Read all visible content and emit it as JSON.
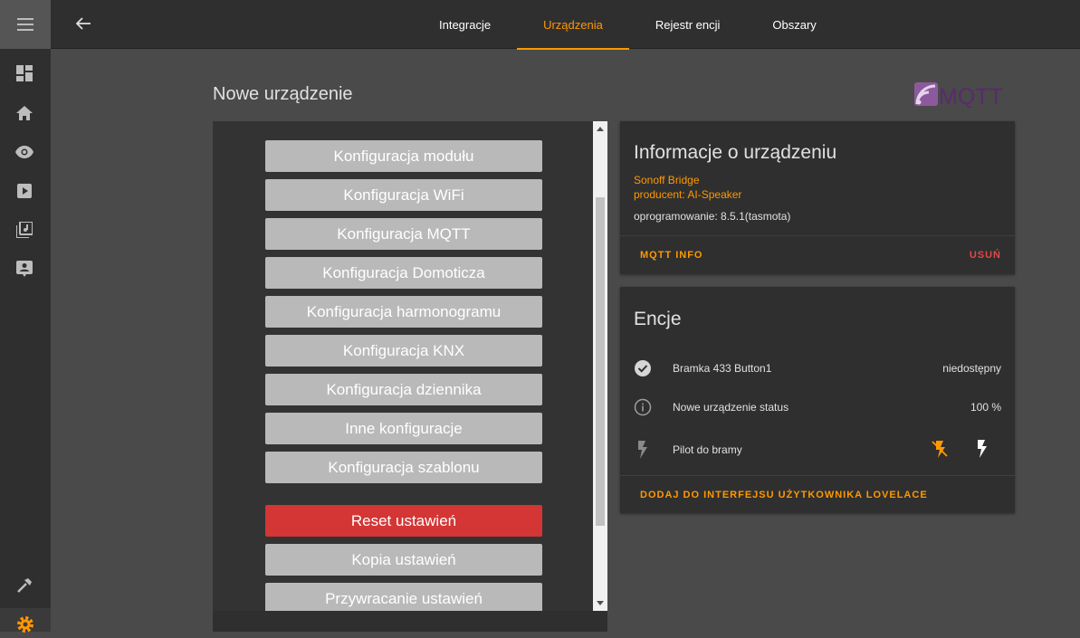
{
  "tabs": [
    "Integracje",
    "Urządzenia",
    "Rejestr encji",
    "Obszary"
  ],
  "active_tab": "Urządzenia",
  "page_title": "Nowe urządzenie",
  "logo_text": "MQTT",
  "config_buttons": [
    "Konfiguracja modułu",
    "Konfiguracja WiFi",
    "Konfiguracja MQTT",
    "Konfiguracja Domoticza",
    "Konfiguracja harmonogramu",
    "Konfiguracja KNX",
    "Konfiguracja dziennika",
    "Inne konfiguracje",
    "Konfiguracja szablonu"
  ],
  "reset_button": "Reset ustawień",
  "backup_button": "Kopia ustawień",
  "restore_button": "Przywracanie ustawień",
  "device_info": {
    "title": "Informacje o urządzeniu",
    "model": "Sonoff Bridge",
    "manufacturer": "producent: AI-Speaker",
    "firmware": "oprogramowanie: 8.5.1(tasmota)",
    "mqtt_info": "MQTT INFO",
    "delete": "USUŃ"
  },
  "entities": {
    "title": "Encje",
    "rows": [
      {
        "name": "Bramka 433 Button1",
        "state": "niedostępny",
        "icon": "check-circle-icon"
      },
      {
        "name": "Nowe urządzenie status",
        "state": "100 %",
        "icon": "info-icon"
      },
      {
        "name": "Pilot do bramy",
        "state": "",
        "icon": "flash-icon"
      }
    ],
    "add_lovelace": "DODAJ DO INTERFEJSU UŻYTKOWNIKA LOVELACE"
  },
  "colors": {
    "accent": "#ff9800",
    "danger": "#d43535",
    "button_gray": "#b9b9b9"
  }
}
